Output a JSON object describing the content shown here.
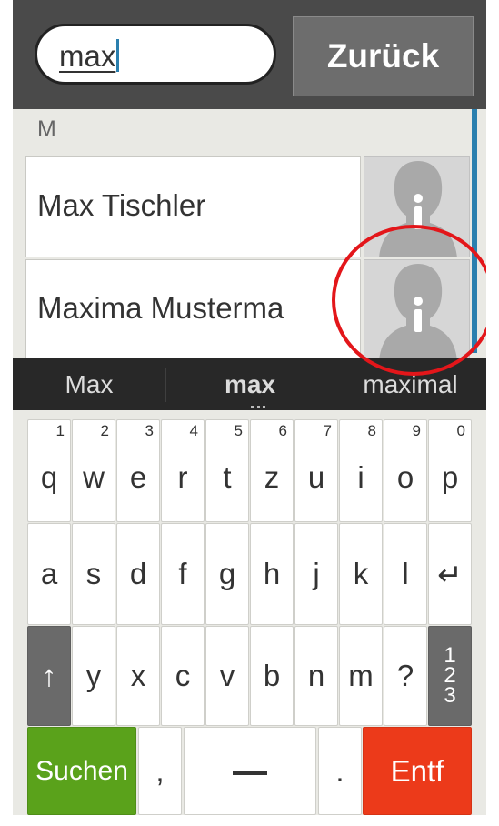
{
  "search": {
    "value": "max"
  },
  "back_button": {
    "label": "Zurück"
  },
  "contacts": {
    "section": "M",
    "items": [
      {
        "name": "Max Tischler",
        "avatar_icon": "contact-info-icon"
      },
      {
        "name": "Maxima Musterma",
        "avatar_icon": "contact-info-icon"
      }
    ]
  },
  "suggestions": [
    {
      "label": "Max"
    },
    {
      "label": "max"
    },
    {
      "label": "maximal"
    }
  ],
  "keyboard": {
    "row1": [
      {
        "num": "1",
        "ch": "q"
      },
      {
        "num": "2",
        "ch": "w"
      },
      {
        "num": "3",
        "ch": "e"
      },
      {
        "num": "4",
        "ch": "r"
      },
      {
        "num": "5",
        "ch": "t"
      },
      {
        "num": "6",
        "ch": "z"
      },
      {
        "num": "7",
        "ch": "u"
      },
      {
        "num": "8",
        "ch": "i"
      },
      {
        "num": "9",
        "ch": "o"
      },
      {
        "num": "0",
        "ch": "p"
      }
    ],
    "row2": [
      "a",
      "s",
      "d",
      "f",
      "g",
      "h",
      "j",
      "k",
      "l"
    ],
    "enter": "↵",
    "shift": "↑",
    "row3": [
      "y",
      "x",
      "c",
      "v",
      "b",
      "n",
      "m",
      "?"
    ],
    "numbers_key": [
      "1",
      "2",
      "3"
    ],
    "search_key": "Suchen",
    "comma": ",",
    "period": ".",
    "delete_key": "Entf"
  },
  "colors": {
    "accent": "#2a7fae",
    "search_key": "#5aa21b",
    "delete_key": "#ec3a1a",
    "annotation": "#e3161a"
  }
}
